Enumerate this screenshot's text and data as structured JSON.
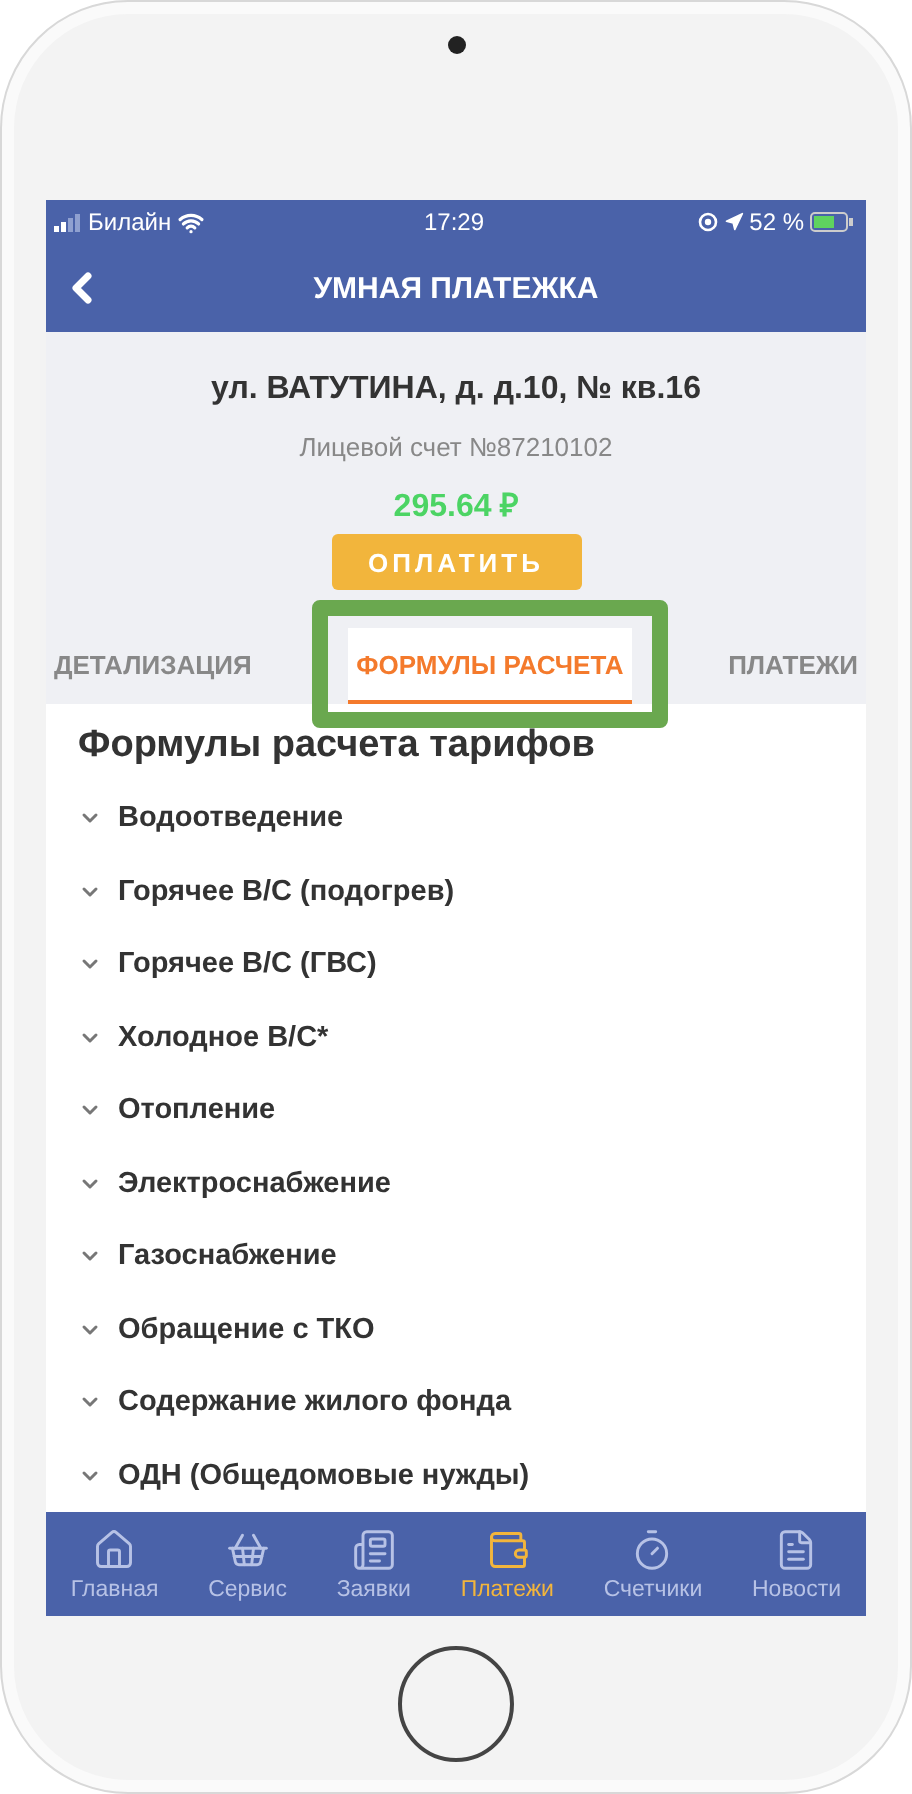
{
  "status_bar": {
    "carrier": "Билайн",
    "time": "17:29",
    "battery": "52 %"
  },
  "header": {
    "title": "УМНАЯ ПЛАТЕЖКА"
  },
  "account": {
    "address": "ул. ВАТУТИНА, д. д.10, № кв.16",
    "number": "Лицевой счет №87210102",
    "amount": "295.64 ₽",
    "pay_button": "ОПЛАТИТЬ"
  },
  "tabs": [
    {
      "label": "ДЕТАЛИЗАЦИЯ",
      "selected": false,
      "highlighted": false
    },
    {
      "label": "ФОРМУЛЫ РАСЧЕТА",
      "selected": true,
      "highlighted": true
    },
    {
      "label": "ПЛАТЕЖИ",
      "selected": false,
      "highlighted": false
    }
  ],
  "section_title": "Формулы расчета тарифов",
  "formulas": [
    {
      "label": "Водоотведение",
      "expanded": false
    },
    {
      "label": "Горячее В/С (подогрев)",
      "expanded": false
    },
    {
      "label": "Горячее В/С (ГВС)",
      "expanded": false
    },
    {
      "label": "Холодное В/С*",
      "expanded": false
    },
    {
      "label": "Отопление",
      "expanded": false
    },
    {
      "label": "Электроснабжение",
      "expanded": false
    },
    {
      "label": "Газоснабжение",
      "expanded": false
    },
    {
      "label": "Обращение с ТКО",
      "expanded": false
    },
    {
      "label": "Содержание жилого фонда",
      "expanded": false
    },
    {
      "label": "ОДН (Общедомовые нужды)",
      "expanded": false
    }
  ],
  "bottom_nav": [
    {
      "kind": "home",
      "label": "Главная",
      "selected": false
    },
    {
      "kind": "basket",
      "label": "Сервис",
      "selected": false
    },
    {
      "kind": "requests",
      "label": "Заявки",
      "selected": false
    },
    {
      "kind": "wallet",
      "label": "Платежи",
      "selected": true
    },
    {
      "kind": "meter",
      "label": "Счетчики",
      "selected": false
    },
    {
      "kind": "news",
      "label": "Новости",
      "selected": false
    }
  ]
}
